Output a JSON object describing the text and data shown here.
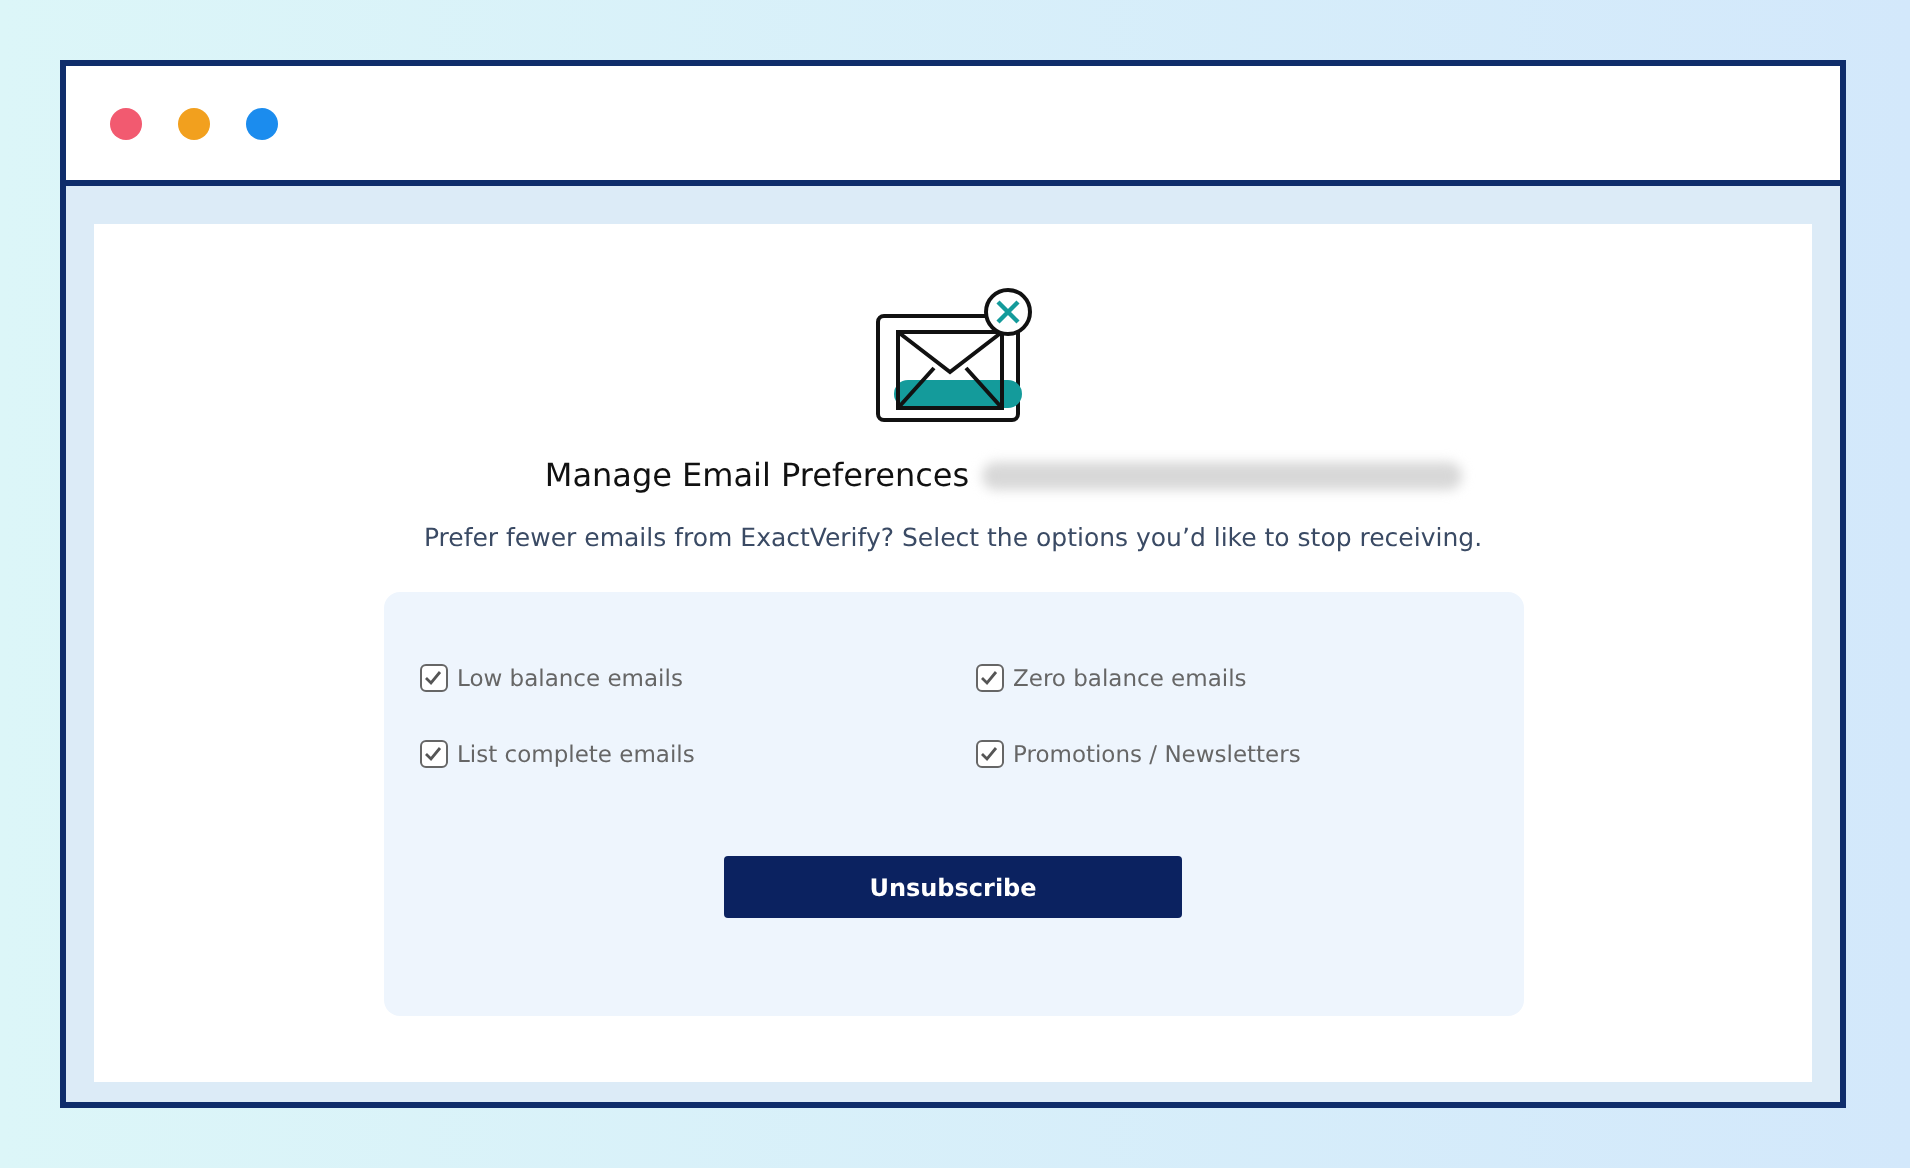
{
  "window": {
    "dots": [
      {
        "color": "#f25a70"
      },
      {
        "color": "#f2a01e"
      },
      {
        "color": "#1b8cee"
      }
    ]
  },
  "title": "Manage Email Preferences",
  "subtitle": "Prefer fewer emails from ExactVerify? Select the options you’d like to stop receiving.",
  "options": [
    {
      "label": "Low balance emails",
      "checked": true
    },
    {
      "label": "Zero balance emails",
      "checked": true
    },
    {
      "label": "List complete emails",
      "checked": true
    },
    {
      "label": "Promotions / Newsletters",
      "checked": true
    }
  ],
  "button": "Unsubscribe"
}
